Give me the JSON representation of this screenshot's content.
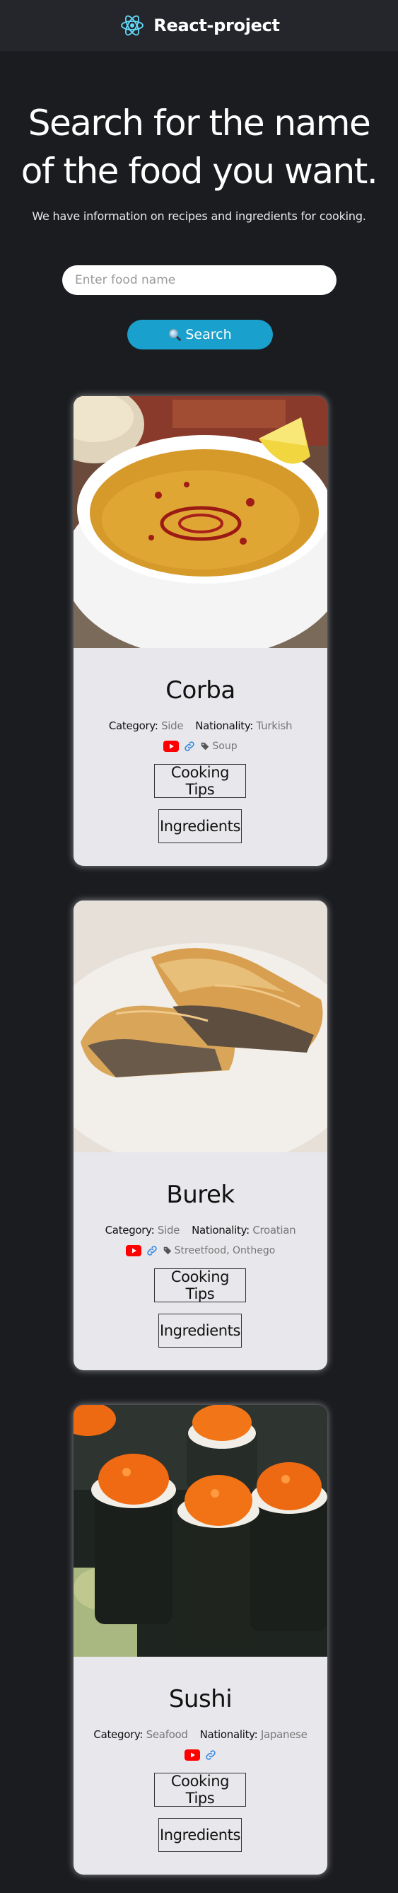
{
  "app": {
    "title": "React-project",
    "logo_icon": "react-logo-icon",
    "accent": "#61dafb"
  },
  "hero": {
    "title": "Search for the name of the food you want.",
    "subtitle": "We have information on recipes and ingredients for cooking."
  },
  "search": {
    "placeholder": "Enter food name",
    "value": "",
    "button_label": "Search",
    "button_icon": "magnifier-icon",
    "button_color": "#1aa0cc"
  },
  "labels": {
    "category": "Category:",
    "nationality": "Nationality:"
  },
  "meals": [
    {
      "name": "Corba",
      "category": "Side",
      "nationality": "Turkish",
      "tags": "Soup",
      "tips_label": "Cooking Tips",
      "ingredients_label": "Ingredients"
    },
    {
      "name": "Burek",
      "category": "Side",
      "nationality": "Croatian",
      "tags": "Streetfood, Onthego",
      "tips_label": "Cooking Tips",
      "ingredients_label": "Ingredients"
    },
    {
      "name": "Sushi",
      "category": "Seafood",
      "nationality": "Japanese",
      "tags": "",
      "tips_label": "Cooking Tips",
      "ingredients_label": "Ingredients"
    }
  ]
}
